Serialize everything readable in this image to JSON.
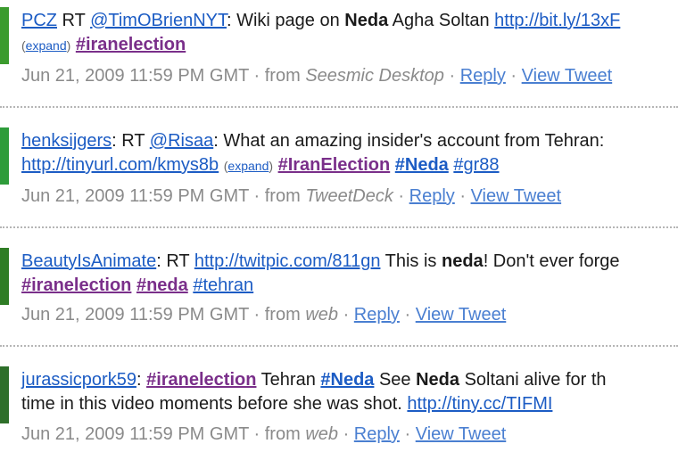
{
  "tweets": [
    {
      "user": "PCZ",
      "colon": ":",
      "rt": " RT ",
      "mention": "@TimOBrienNYT",
      "t1": ": Wiki page on ",
      "bold1": "Neda",
      "t2": " Agha Soltan ",
      "url": "http://bit.ly/13xF",
      "expand_open": "(",
      "expand": "expand",
      "expand_close": ")",
      "hashtag": "#iranelection",
      "timestamp": "Jun 21, 2009 11:59 PM GMT",
      "from": " · from ",
      "source": "Seesmic Desktop",
      "reply": "Reply",
      "dot": " · ",
      "view": "View Tweet",
      "avatar_color": "#3b9b2e"
    },
    {
      "user": "henksijgers",
      "colon": ":",
      "rt": " RT ",
      "mention": "@Risaa",
      "t1": ": What an amazing insider's account from Tehran:",
      "url": "http://tinyurl.com/kmys8b",
      "expand_open": "(",
      "expand": "expand",
      "expand_close": ")",
      "hashtag1": "#IranElection",
      "hashtag2": "#Neda",
      "hashtag3": "#gr88",
      "timestamp": "Jun 21, 2009 11:59 PM GMT",
      "from": " · from ",
      "source": "TweetDeck",
      "reply": "Reply",
      "dot": " · ",
      "view": "View Tweet",
      "avatar_color": "#2e9c3a"
    },
    {
      "user": "BeautyIsAnimate",
      "colon": ":",
      "rt": " RT ",
      "url": "http://twitpic.com/811gn",
      "t1": " This is ",
      "bold1": "neda",
      "t2": "! Don't ever forge",
      "hashtag1": "#iranelection",
      "hashtag2": "#neda",
      "hashtag3": "#tehran",
      "timestamp": "Jun 21, 2009 11:59 PM GMT",
      "from": " · from ",
      "source": "web",
      "reply": "Reply",
      "dot": " · ",
      "view": "View Tweet",
      "avatar_color": "#2f7d25"
    },
    {
      "user": "jurassicpork59",
      "colon": ":",
      "hashtag1": "#iranelection",
      "t1": " Tehran ",
      "hashtag2": "#Neda",
      "t2": " See ",
      "bold1": "Neda",
      "t3": " Soltani alive for th",
      "t4": "time in this video moments before she was shot. ",
      "url": "http://tiny.cc/TIFMI",
      "timestamp": "Jun 21, 2009 11:59 PM GMT",
      "from": " · from ",
      "source": "web",
      "reply": "Reply",
      "dot": " · ",
      "view": "View Tweet",
      "avatar_color": "#2e6f2a"
    }
  ]
}
